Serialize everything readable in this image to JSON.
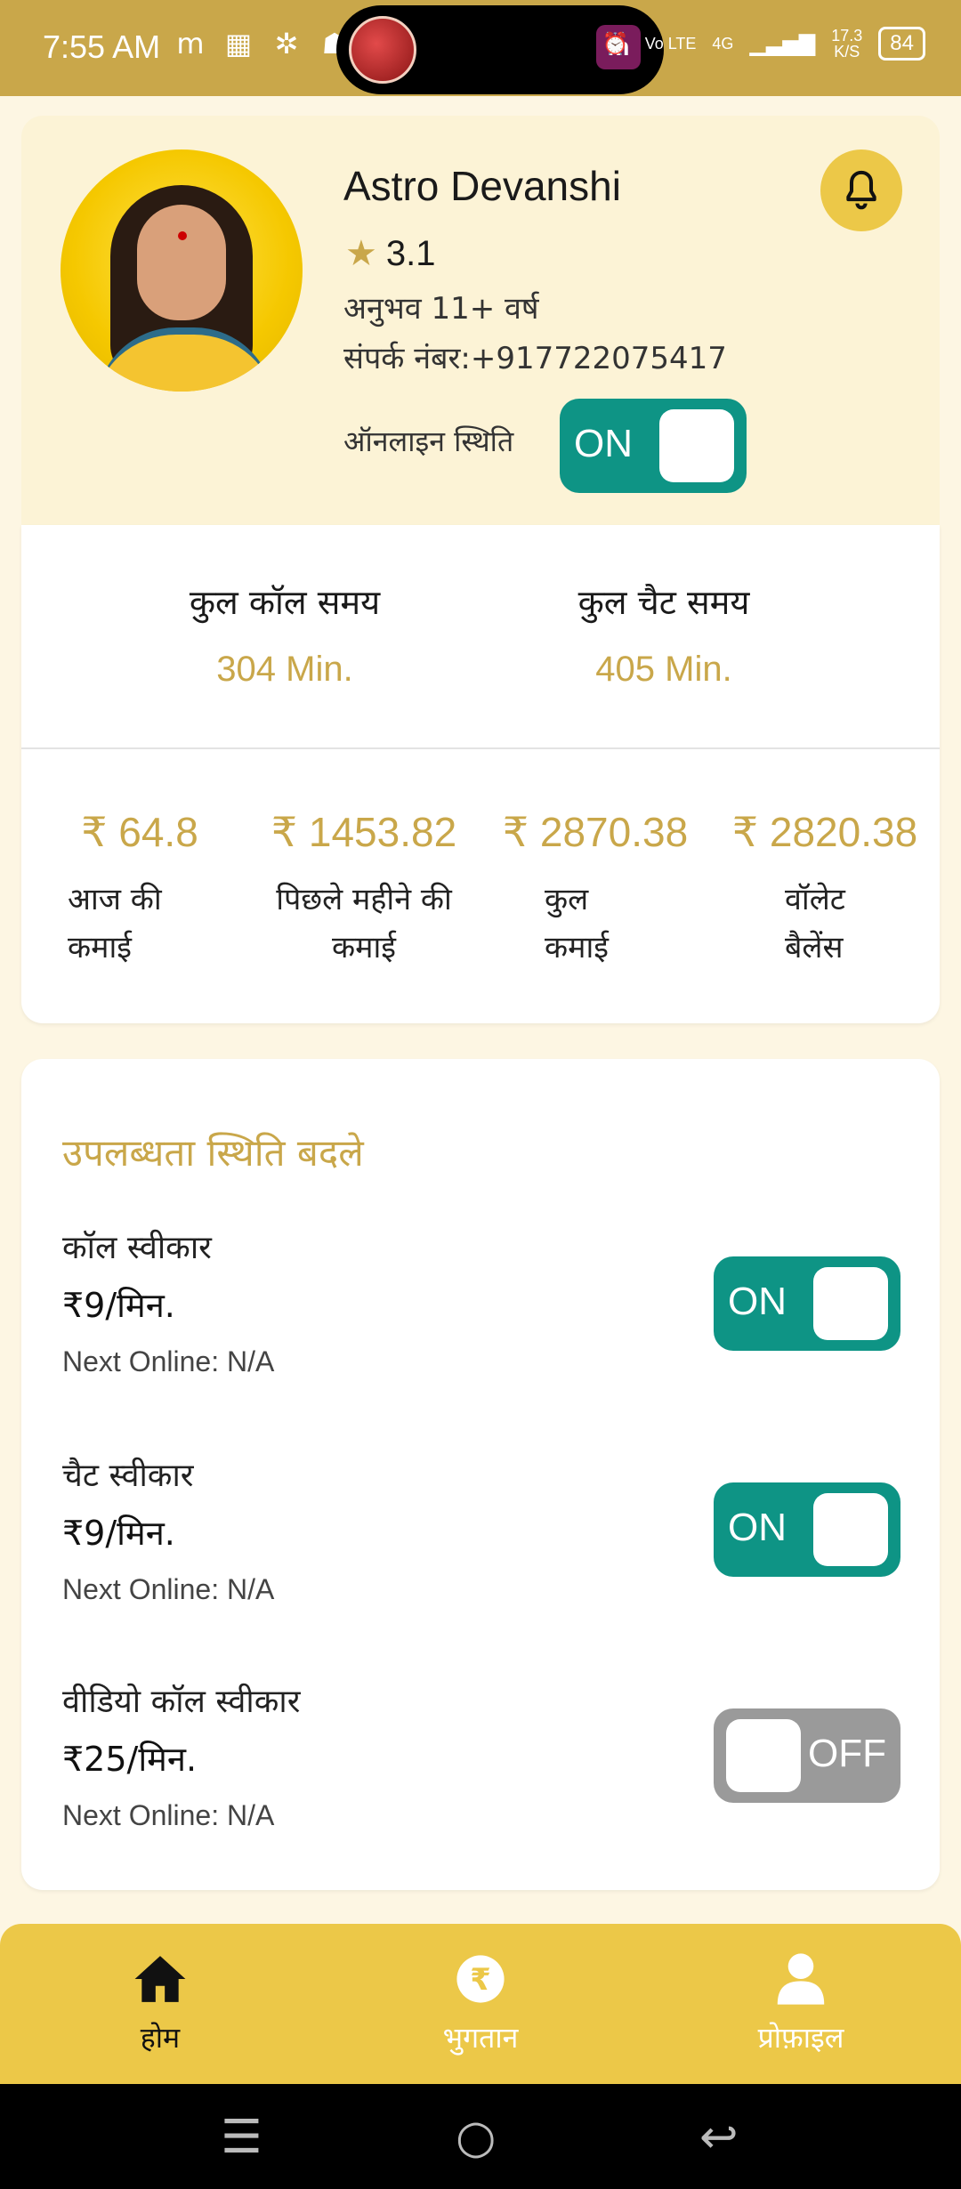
{
  "status_bar": {
    "time": "7:55 AM",
    "net_type": "Vo LTE",
    "signal": "4G",
    "speed_value": "17.3",
    "speed_unit": "K/S",
    "battery": "84"
  },
  "profile": {
    "name": "Astro Devanshi",
    "rating": "3.1",
    "experience": "अनुभव 11+ वर्ष",
    "contact": "संपर्क नंबर:+917722075417",
    "online_status_label": "ऑनलाइन स्थिति",
    "online_toggle": "ON"
  },
  "stats": {
    "call_time_label": "कुल कॉल समय",
    "call_time_value": "304 Min.",
    "chat_time_label": "कुल चैट समय",
    "chat_time_value": "405 Min."
  },
  "earnings": [
    {
      "amount": "₹ 64.8",
      "label_line1": "आज की",
      "label_line2": "कमाई"
    },
    {
      "amount": "₹ 1453.82",
      "label_line1": "पिछले महीने की",
      "label_line2": "कमाई"
    },
    {
      "amount": "₹ 2870.38",
      "label_line1": "कुल",
      "label_line2": "कमाई"
    },
    {
      "amount": "₹ 2820.38",
      "label_line1": "वॉलेट",
      "label_line2": "बैलेंस"
    }
  ],
  "availability": {
    "title": "उपलब्धता स्थिति बदले",
    "rows": [
      {
        "title": "कॉल स्वीकार",
        "price": "₹9/मिन.",
        "next": "Next Online: N/A",
        "toggle": "ON"
      },
      {
        "title": "चैट स्वीकार",
        "price": "₹9/मिन.",
        "next": "Next Online: N/A",
        "toggle": "ON"
      },
      {
        "title": "वीडियो कॉल स्वीकार",
        "price": "₹25/मिन.",
        "next": "Next Online: N/A",
        "toggle": "OFF"
      }
    ]
  },
  "bottom_nav": {
    "home": "होम",
    "payment": "भुगतान",
    "profile": "प्रोफ़ाइल"
  },
  "colors": {
    "accent_gold": "#c9a74a",
    "nav_yellow": "#ecc848",
    "toggle_on": "#0e9485",
    "toggle_off": "#9a9a9a"
  }
}
